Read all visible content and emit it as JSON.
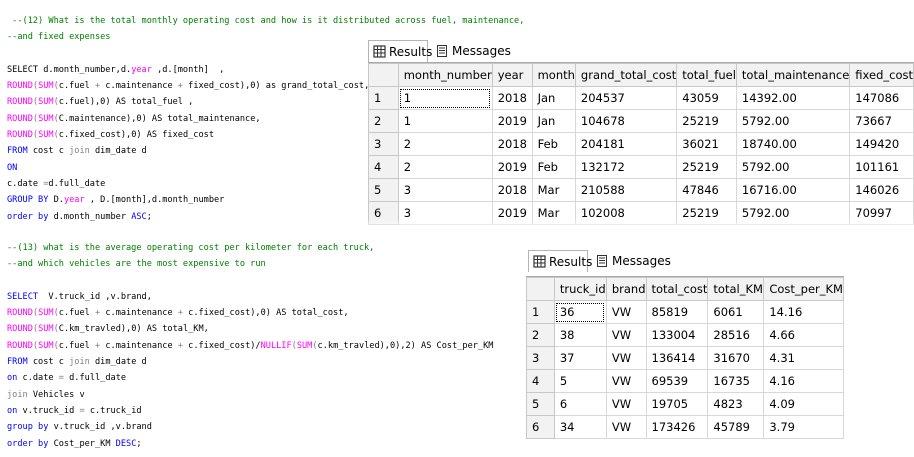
{
  "query12": {
    "comment": [
      " --(12) What is the total monthly operating cost and how is it distributed across fuel, maintenance,",
      "--and fixed expenses"
    ],
    "sql": [
      [
        [
          "tx",
          "SELECT d.month_number,d."
        ],
        [
          "fn",
          "year"
        ],
        [
          "tx",
          " ,d.[month]  ,"
        ]
      ],
      [
        [
          "fn",
          "ROUND"
        ],
        [
          "gr",
          "("
        ],
        [
          "fn",
          "SUM"
        ],
        [
          "gr",
          "("
        ],
        [
          "tx",
          "c.fuel "
        ],
        [
          "gr",
          "+"
        ],
        [
          "tx",
          " c.maintenance "
        ],
        [
          "gr",
          "+"
        ],
        [
          "tx",
          " fixed_cost),0) as grand_total_cost,"
        ]
      ],
      [
        [
          "fn",
          "ROUND"
        ],
        [
          "gr",
          "("
        ],
        [
          "fn",
          "SUM"
        ],
        [
          "gr",
          "("
        ],
        [
          "tx",
          "c.fuel),0) AS total_fuel ,"
        ]
      ],
      [
        [
          "fn",
          "ROUND"
        ],
        [
          "gr",
          "("
        ],
        [
          "fn",
          "SUM"
        ],
        [
          "gr",
          "("
        ],
        [
          "tx",
          "C.maintenance),0) AS total_maintenance,"
        ]
      ],
      [
        [
          "fn",
          "ROUND"
        ],
        [
          "gr",
          "("
        ],
        [
          "fn",
          "SUM"
        ],
        [
          "gr",
          "("
        ],
        [
          "tx",
          "c.fixed_cost),0) AS fixed_cost"
        ]
      ],
      [
        [
          "kw",
          "FROM"
        ],
        [
          "tx",
          " cost c "
        ],
        [
          "gr",
          "join"
        ],
        [
          "tx",
          " dim_date d"
        ]
      ],
      [
        [
          "kw",
          "ON"
        ]
      ],
      [
        [
          "tx",
          "c.date "
        ],
        [
          "gr",
          "="
        ],
        [
          "tx",
          "d.full_date"
        ]
      ],
      [
        [
          "kw",
          "GROUP BY"
        ],
        [
          "tx",
          " D."
        ],
        [
          "fn",
          "year"
        ],
        [
          "tx",
          " , D.[month],d.month_number"
        ]
      ],
      [
        [
          "kw",
          "order by"
        ],
        [
          "tx",
          " d.month_number "
        ],
        [
          "kw",
          "ASC"
        ],
        [
          "tx",
          ";"
        ]
      ]
    ]
  },
  "query13": {
    "comment": [
      "--(13) what is the average operating cost per kilometer for each truck,",
      "--and which vehicles are the most expensive to run"
    ],
    "sql": [
      [
        [
          "kw",
          "SELECT"
        ],
        [
          "tx",
          "  V.truck_id ,v.brand,"
        ]
      ],
      [
        [
          "fn",
          "ROUND"
        ],
        [
          "gr",
          "("
        ],
        [
          "fn",
          "SUM"
        ],
        [
          "gr",
          "("
        ],
        [
          "tx",
          "c.fuel "
        ],
        [
          "gr",
          "+"
        ],
        [
          "tx",
          " c.maintenance "
        ],
        [
          "gr",
          "+"
        ],
        [
          "tx",
          " c.fixed_cost),0) AS total_cost,"
        ]
      ],
      [
        [
          "fn",
          "ROUND"
        ],
        [
          "gr",
          "("
        ],
        [
          "fn",
          "SUM"
        ],
        [
          "gr",
          "("
        ],
        [
          "tx",
          "C.km_travled),0) AS total_KM,"
        ]
      ],
      [
        [
          "fn",
          "ROUND"
        ],
        [
          "gr",
          "("
        ],
        [
          "fn",
          "SUM"
        ],
        [
          "gr",
          "("
        ],
        [
          "tx",
          "c.fuel "
        ],
        [
          "gr",
          "+"
        ],
        [
          "tx",
          " c.maintenance "
        ],
        [
          "gr",
          "+"
        ],
        [
          "tx",
          " c.fixed_cost)/"
        ],
        [
          "fn",
          "NULLIF"
        ],
        [
          "gr",
          "("
        ],
        [
          "fn",
          "SUM"
        ],
        [
          "gr",
          "("
        ],
        [
          "tx",
          "c.km_travled),0),2) AS Cost_per_KM"
        ]
      ],
      [
        [
          "kw",
          "FROM"
        ],
        [
          "tx",
          " cost c "
        ],
        [
          "gr",
          "join"
        ],
        [
          "tx",
          " dim_date d"
        ]
      ],
      [
        [
          "kw",
          "on"
        ],
        [
          "tx",
          " c.date "
        ],
        [
          "gr",
          "="
        ],
        [
          "tx",
          " d.full_date"
        ]
      ],
      [
        [
          "gr",
          "join"
        ],
        [
          "tx",
          " Vehicles v"
        ]
      ],
      [
        [
          "kw",
          "on"
        ],
        [
          "tx",
          " v.truck_id "
        ],
        [
          "gr",
          "="
        ],
        [
          "tx",
          " c.truck_id"
        ]
      ],
      [
        [
          "kw",
          "group by"
        ],
        [
          "tx",
          " v.truck_id ,v.brand"
        ]
      ],
      [
        [
          "kw",
          "order by"
        ],
        [
          "tx",
          " Cost_per_KM "
        ],
        [
          "kw",
          "DESC"
        ],
        [
          "tx",
          ";"
        ]
      ]
    ]
  },
  "results1": {
    "tab_results": "Results",
    "tab_messages": "Messages",
    "columns": [
      "month_number",
      "year",
      "month",
      "grand_total_cost",
      "total_fuel",
      "total_maintenance",
      "fixed_cost"
    ],
    "rows": [
      [
        "1",
        "1",
        "2018",
        "Jan",
        "204537",
        "43059",
        "14392.00",
        "147086"
      ],
      [
        "2",
        "1",
        "2019",
        "Jan",
        "104678",
        "25219",
        "5792.00",
        "73667"
      ],
      [
        "3",
        "2",
        "2018",
        "Feb",
        "204181",
        "36021",
        "18740.00",
        "149420"
      ],
      [
        "4",
        "2",
        "2019",
        "Feb",
        "132172",
        "25219",
        "5792.00",
        "101161"
      ],
      [
        "5",
        "3",
        "2018",
        "Mar",
        "210588",
        "47846",
        "16716.00",
        "146026"
      ],
      [
        "6",
        "3",
        "2019",
        "Mar",
        "102008",
        "25219",
        "5792.00",
        "70997"
      ]
    ]
  },
  "results2": {
    "tab_results": "Results",
    "tab_messages": "Messages",
    "columns": [
      "truck_id",
      "brand",
      "total_cost",
      "total_KM",
      "Cost_per_KM"
    ],
    "rows": [
      [
        "1",
        "36",
        "VW",
        "85819",
        "6061",
        "14.16"
      ],
      [
        "2",
        "38",
        "VW",
        "133004",
        "28516",
        "4.66"
      ],
      [
        "3",
        "37",
        "VW",
        "136414",
        "31670",
        "4.31"
      ],
      [
        "4",
        "5",
        "VW",
        "69539",
        "16735",
        "4.16"
      ],
      [
        "5",
        "6",
        "VW",
        "19705",
        "4823",
        "4.09"
      ],
      [
        "6",
        "34",
        "VW",
        "173426",
        "45789",
        "3.79"
      ]
    ]
  }
}
